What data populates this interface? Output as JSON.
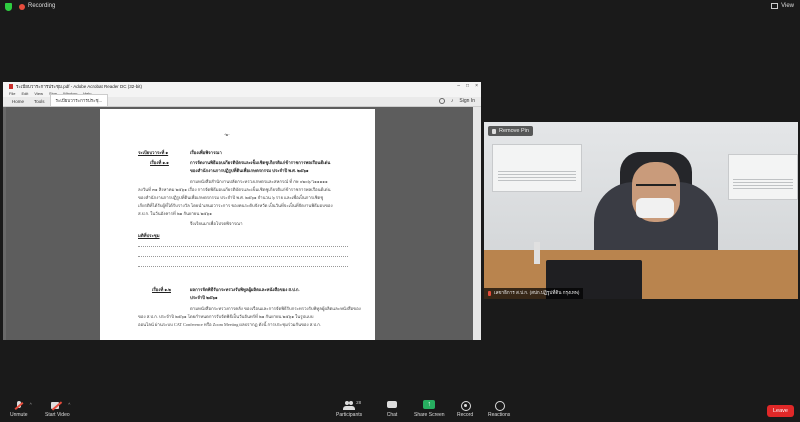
{
  "topbar": {
    "recording_label": "Recording",
    "view_label": "View"
  },
  "acrobat": {
    "title": "ระเบียบวาระการประชุม.pdf - Adobe Acrobat Reader DC (32-bit)",
    "menu": [
      "File",
      "Edit",
      "View",
      "Sign",
      "Window",
      "Help"
    ],
    "tabs": [
      "Home",
      "Tools",
      "ระเบียบวาระการประชุ..."
    ],
    "sign_in": "Sign In",
    "page_number": "-๒-",
    "doc": {
      "agenda_label": "ระเบียบวาระที่ ๑",
      "agenda_title": "เรื่องเพื่อพิจารณา",
      "item1_label": "เรื่องที่ ๑.๑",
      "item1_title_1": "การจัดงานพิธีมอบเกียรติบัตรและเข็มเชิดชูเกียรติแก่ข้าราชการพลเรือนดีเด่น",
      "item1_title_2": "ของสำนักงานการปฏิรูปที่ดินเพื่อเกษตรกรรม ประจำปี พ.ศ. ๒๕๖๑",
      "body1_1": "ตามหนังสือสำนักงานปลัดกระทรวงเกษตรและสหกรณ์ ที่ กษ ๐๒๐๖/ว๑๑๑๑๑",
      "body1_2": "ลงวันที่ ๓๑ สิงหาคม ๒๕๖๑ เรื่อง การจัดพิธีมอบเกียรติบัตรและเข็มเชิดชูเกียรติแก่ข้าราชการพลเรือนดีเด่น",
      "body1_3": "ของสำนักงานการปฏิรูปที่ดินเพื่อเกษตรกรรม ประจำปี พ.ศ. ๒๕๖๑ จำนวน ๖ ราย และเพื่อเป็นการเชิดชู",
      "body1_4": "เกียรติที่ได้รับผู้ที่ได้รับรางวัล โดยนำเสนอวาระการ ของคนระดับจังหวัด เป็นวันที่จะเป็นที่จัดงานพิธีมอบของ",
      "body1_5": "ส.ป.ก. ในวันอังคารที่ ๒๑ กันยายน ๒๕๖๑",
      "body1_6": "จึงเรียนมาเพื่อโปรดพิจารณา",
      "resolution_label": "มติที่ประชุม",
      "item2_label": "เรื่องที่ ๑.๒",
      "item2_title_1": "ผลการจัดพิธีรับกระทรวงรับพิทูลผู้ผลิตและหนังสือของ ส.ป.ก.",
      "item2_title_2": "ประจำปี ๒๕๖๑",
      "body2_1": "ตามหนังสือกระทรวงการคลัง ของเรือนและการจัดพิธีรับกระทรวงรับพิทูลผู้ผลิตและหนังสือของ",
      "body2_2": "ของ ส.ป.ก. ประจำปี ๒๕๖๑ โดยกำหนดการรับจัดพิธีเป็นวันจันทร์ที่ ๒๑ กันยายน ๒๕๖๑ ในรูปแบบ",
      "body2_3": "ออนไลน์ ผ่านระบบ CAT Conference หรือ Zoom Meeting ผลปรากฏ ดังนี้ การประชุมร่วมกันของ ส.ป.ก."
    }
  },
  "video": {
    "remove_pin": "Remove Pin",
    "participant_name": "เลขาธิการ ส.ป.ก. (สปก.ปฏิรูปที่ดิน กรุงเทพ)"
  },
  "controls": {
    "unmute": "Unmute",
    "start_video": "Start Video",
    "participants": "Participants",
    "participants_count": "28",
    "chat": "Chat",
    "share_screen": "Share Screen",
    "record": "Record",
    "reactions": "Reactions",
    "leave": "Leave"
  }
}
